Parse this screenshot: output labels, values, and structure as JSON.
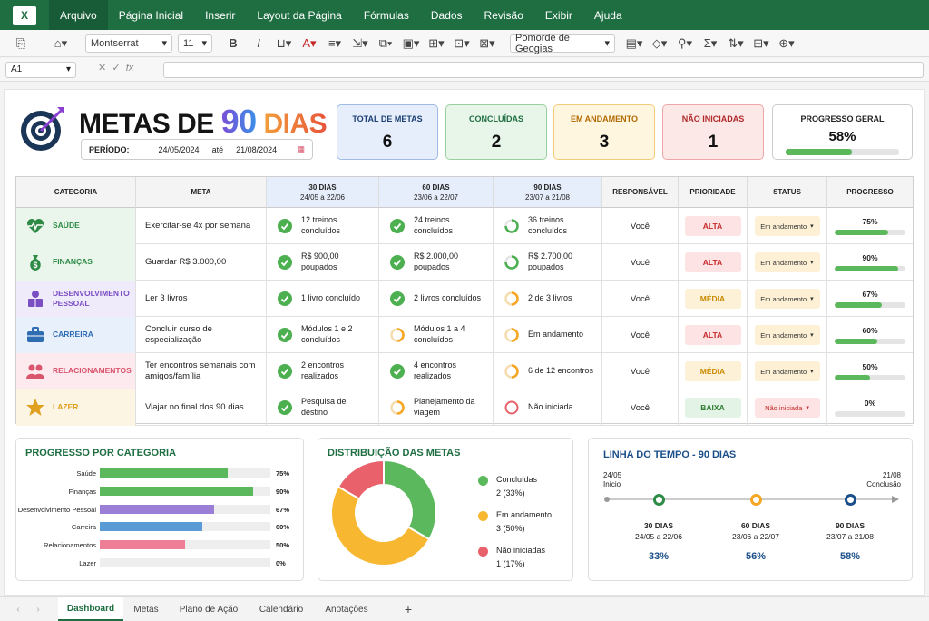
{
  "ribbon": {
    "menu": [
      "Arquivo",
      "Página Inicial",
      "Inserir",
      "Layout da Página",
      "Fórmulas",
      "Dados",
      "Revisão",
      "Exibir",
      "Ajuda"
    ],
    "font": "Montserrat",
    "size": "11",
    "style": "Pomorde de Geogias"
  },
  "formula": {
    "cell": "A1",
    "fx": "fx"
  },
  "header": {
    "title_a": "METAS DE ",
    "title_b": "90",
    "title_c": " DIAS",
    "period_label": "PERÍODO:",
    "start": "24/05/2024",
    "until": "até",
    "end": "21/08/2024"
  },
  "kpis": [
    {
      "label": "TOTAL DE METAS",
      "value": "6",
      "bg": "#e6eefb",
      "border": "#9fbbe6",
      "color": "#1b3f73"
    },
    {
      "label": "CONCLUÍDAS",
      "value": "2",
      "bg": "#e8f5e9",
      "border": "#9ccf9f",
      "color": "#1e6e42"
    },
    {
      "label": "EM ANDAMENTO",
      "value": "3",
      "bg": "#fff6e0",
      "border": "#f2cc7a",
      "color": "#b26a00"
    },
    {
      "label": "NÃO INICIADAS",
      "value": "1",
      "bg": "#fde8e8",
      "border": "#eea6a6",
      "color": "#b12a2a"
    }
  ],
  "overall": {
    "label": "PROGRESSO GERAL",
    "value": "58%",
    "fraction": 0.58
  },
  "table": {
    "headers": {
      "categoria": "CATEGORIA",
      "meta": "META",
      "d30": "30 DIAS",
      "d30_sub": "24/05 a 22/06",
      "d60": "60 DIAS",
      "d60_sub": "23/06 a 22/07",
      "d90": "90 DIAS",
      "d90_sub": "23/07 a 21/08",
      "resp": "RESPONSÁVEL",
      "prio": "PRIORIDADE",
      "status": "STATUS",
      "prog": "PROGRESSO"
    },
    "rows": [
      {
        "cat": "SAÚDE",
        "icon": "heart-pulse-icon",
        "bg": "#eaf6ec",
        "color": "#2e8b46",
        "meta": "Exercitar-se 4x por semana",
        "p": [
          {
            "t": "12 treinos concluídos",
            "s": "done"
          },
          {
            "t": "24 treinos concluídos",
            "s": "done"
          },
          {
            "t": "36 treinos concluídos",
            "s": "partial"
          }
        ],
        "resp": "Você",
        "prio": "ALTA",
        "status": "Em andamento",
        "prog": "75%",
        "fraction": 0.75
      },
      {
        "cat": "FINANÇAS",
        "icon": "money-bag-icon",
        "bg": "#eaf6ec",
        "color": "#2e8b46",
        "meta": "Guardar R$ 3.000,00",
        "p": [
          {
            "t": "R$ 900,00 poupados",
            "s": "done"
          },
          {
            "t": "R$ 2.000,00 poupados",
            "s": "done"
          },
          {
            "t": "R$ 2.700,00 poupados",
            "s": "partial"
          }
        ],
        "resp": "Você",
        "prio": "ALTA",
        "status": "Em andamento",
        "prog": "90%",
        "fraction": 0.9
      },
      {
        "cat": "DESENVOLVIMENTO PESSOAL",
        "icon": "person-book-icon",
        "bg": "#f0ebfa",
        "color": "#7a4fc4",
        "meta": "Ler 3 livros",
        "p": [
          {
            "t": "1 livro concluído",
            "s": "done"
          },
          {
            "t": "2 livros concluídos",
            "s": "done"
          },
          {
            "t": "2 de 3 livros",
            "s": "progress"
          }
        ],
        "resp": "Você",
        "prio": "MÉDIA",
        "status": "Em andamento",
        "prog": "67%",
        "fraction": 0.67
      },
      {
        "cat": "CARREIRA",
        "icon": "briefcase-icon",
        "bg": "#e8f0fb",
        "color": "#2f6db3",
        "meta": "Concluir curso de especialização",
        "p": [
          {
            "t": "Módulos 1 e 2 concluídos",
            "s": "done"
          },
          {
            "t": "Módulos 1 a 4 concluídos",
            "s": "progress"
          },
          {
            "t": "Em andamento",
            "s": "progress"
          }
        ],
        "resp": "Você",
        "prio": "ALTA",
        "status": "Em andamento",
        "prog": "60%",
        "fraction": 0.6
      },
      {
        "cat": "RELACIONAMENTOS",
        "icon": "people-icon",
        "bg": "#fdeaef",
        "color": "#d9546d",
        "meta": "Ter encontros semanais com amigos/família",
        "p": [
          {
            "t": "2 encontros realizados",
            "s": "done"
          },
          {
            "t": "4 encontros realizados",
            "s": "done"
          },
          {
            "t": "6 de 12 encontros",
            "s": "progress"
          }
        ],
        "resp": "Você",
        "prio": "MÉDIA",
        "status": "Em andamento",
        "prog": "50%",
        "fraction": 0.5
      },
      {
        "cat": "LAZER",
        "icon": "star-icon",
        "bg": "#fdf5e3",
        "color": "#e0a020",
        "meta": "Viajar no final dos 90 dias",
        "p": [
          {
            "t": "Pesquisa de destino",
            "s": "done"
          },
          {
            "t": "Planejamento da viagem",
            "s": "progress"
          },
          {
            "t": "Não iniciada",
            "s": "none"
          }
        ],
        "resp": "Você",
        "prio": "BAIXA",
        "status": "Não iniciada",
        "prog": "0%",
        "fraction": 0.0
      }
    ]
  },
  "priority_colors": {
    "ALTA": {
      "bg": "#fde3e3",
      "fg": "#c62828"
    },
    "MÉDIA": {
      "bg": "#fdf1d8",
      "fg": "#c98a00"
    },
    "BAIXA": {
      "bg": "#e3f4e6",
      "fg": "#2e7d32"
    }
  },
  "status_colors": {
    "Em andamento": {
      "bg": "#fdf0d5",
      "fg": "#333"
    },
    "Não iniciada": {
      "bg": "#fde3e3",
      "fg": "#c62828"
    }
  },
  "by_category": {
    "title": "PROGRESSO POR CATEGORIA",
    "items": [
      {
        "label": "Saúde",
        "value": "75%",
        "fraction": 0.75,
        "color": "#5cb85c"
      },
      {
        "label": "Finanças",
        "value": "90%",
        "fraction": 0.9,
        "color": "#5cb85c"
      },
      {
        "label": "Desenvolvimento Pessoal",
        "value": "67%",
        "fraction": 0.67,
        "color": "#9b7ed6"
      },
      {
        "label": "Carreira",
        "value": "60%",
        "fraction": 0.6,
        "color": "#5b9bd5"
      },
      {
        "label": "Relacionamentos",
        "value": "50%",
        "fraction": 0.5,
        "color": "#ee7d96"
      },
      {
        "label": "Lazer",
        "value": "0%",
        "fraction": 0.0,
        "color": "#f5b942"
      }
    ]
  },
  "distribution": {
    "title": "DISTRIBUIÇÃO DAS METAS",
    "slices": [
      {
        "name": "Concluídas",
        "count": "2 (33%)",
        "value": 2,
        "color": "#5cb85c"
      },
      {
        "name": "Em andamento",
        "count": "3 (50%)",
        "value": 3,
        "color": "#f7b731"
      },
      {
        "name": "Não iniciadas",
        "count": "1 (17%)",
        "value": 1,
        "color": "#e8616b"
      }
    ]
  },
  "timeline": {
    "title": "LINHA DO TEMPO - 90 DIAS",
    "start_date": "24/05",
    "start_lbl": "Início",
    "end_date": "21/08",
    "end_lbl": "Conclusão",
    "points": [
      {
        "name": "30 DIAS",
        "range": "24/05 a 22/06",
        "pct": "33%",
        "color": "#2e8b46"
      },
      {
        "name": "60 DIAS",
        "range": "23/06 a 22/07",
        "pct": "56%",
        "color": "#f5a623"
      },
      {
        "name": "90 DIAS",
        "range": "23/07 a 21/08",
        "pct": "58%",
        "color": "#1b4f8a"
      }
    ]
  },
  "tabs": [
    "Dashboard",
    "Metas",
    "Plano de Ação",
    "Calendário",
    "Anotações"
  ]
}
